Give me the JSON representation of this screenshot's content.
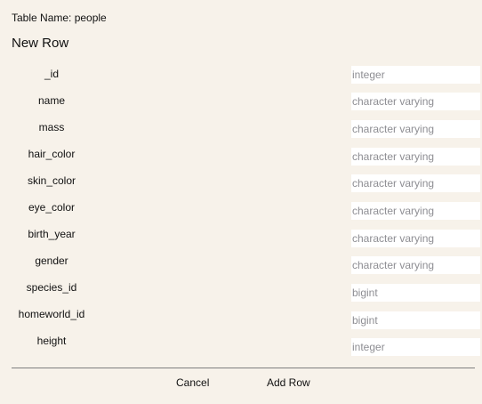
{
  "table_name_label": "Table Name: people",
  "section_title": "New Row",
  "fields": [
    {
      "label": "_id",
      "placeholder": "integer"
    },
    {
      "label": "name",
      "placeholder": "character varying"
    },
    {
      "label": "mass",
      "placeholder": "character varying"
    },
    {
      "label": "hair_color",
      "placeholder": "character varying"
    },
    {
      "label": "skin_color",
      "placeholder": "character varying"
    },
    {
      "label": "eye_color",
      "placeholder": "character varying"
    },
    {
      "label": "birth_year",
      "placeholder": "character varying"
    },
    {
      "label": "gender",
      "placeholder": "character varying"
    },
    {
      "label": "species_id",
      "placeholder": "bigint"
    },
    {
      "label": "homeworld_id",
      "placeholder": "bigint"
    },
    {
      "label": "height",
      "placeholder": "integer"
    }
  ],
  "actions": {
    "cancel_label": "Cancel",
    "add_row_label": "Add Row"
  }
}
